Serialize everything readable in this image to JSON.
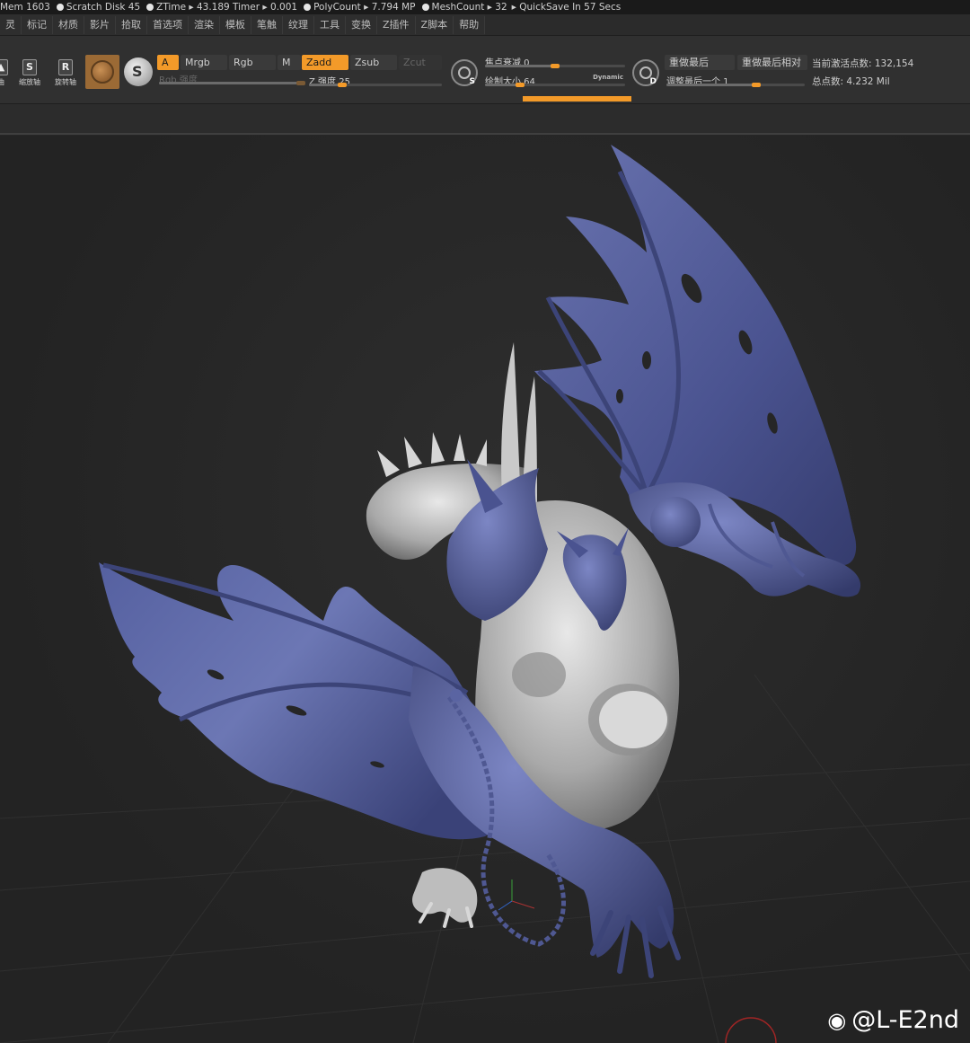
{
  "status_bar": {
    "mem": "Mem 1603",
    "scratch_disk": "Scratch Disk 45",
    "ztime": "ZTime ▸ 43.189 Timer ▸ 0.001",
    "polycount": "PolyCount ▸ 7.794 MP",
    "meshcount": "MeshCount ▸ 32",
    "quicksave": "▸ QuickSave In 57 Secs"
  },
  "menu": {
    "items": [
      "灵",
      "标记",
      "材质",
      "影片",
      "拾取",
      "首选项",
      "渲染",
      "模板",
      "笔触",
      "纹理",
      "工具",
      "变换",
      "Z插件",
      "Z脚本",
      "帮助"
    ]
  },
  "shelf": {
    "tool_left_label": "曲",
    "scale_label": "缩放轴",
    "rotate_label": "旋转轴",
    "scale_glyph": "S",
    "rotate_glyph": "R",
    "btn_a": "A",
    "btn_mrgb": "Mrgb",
    "btn_rgb": "Rgb",
    "btn_m": "M",
    "rgb_intensity": "Rgb 强度",
    "btn_zadd": "Zadd",
    "btn_zsub": "Zsub",
    "btn_zcut": "Zcut",
    "z_intensity": "Z 强度 25",
    "focal_shift": "焦点衰减 0",
    "draw_size": "绘制大小 64",
    "dynamic": "Dynamic",
    "redo_last": "重做最后",
    "redo_last_relative": "重做最后相对",
    "adjust_last": "调整最后一个 1",
    "active_points": "当前激活点数: 132,154",
    "total_points": "总点数: 4.232 Mil",
    "icon_s_letter": "S",
    "icon_d_letter": "D",
    "stroke_glyph": "S"
  },
  "sliders": {
    "rgb_intensity": 1.0,
    "z_intensity": 0.25,
    "focal_shift": 0.5,
    "draw_size": 0.25,
    "adjust_last": 0.65
  },
  "watermark": {
    "text": "@L-E2nd",
    "icon": "weibo-icon"
  },
  "colors": {
    "accent": "#f39a29",
    "wing": "#4f5892",
    "body": "#bdbdbd"
  }
}
